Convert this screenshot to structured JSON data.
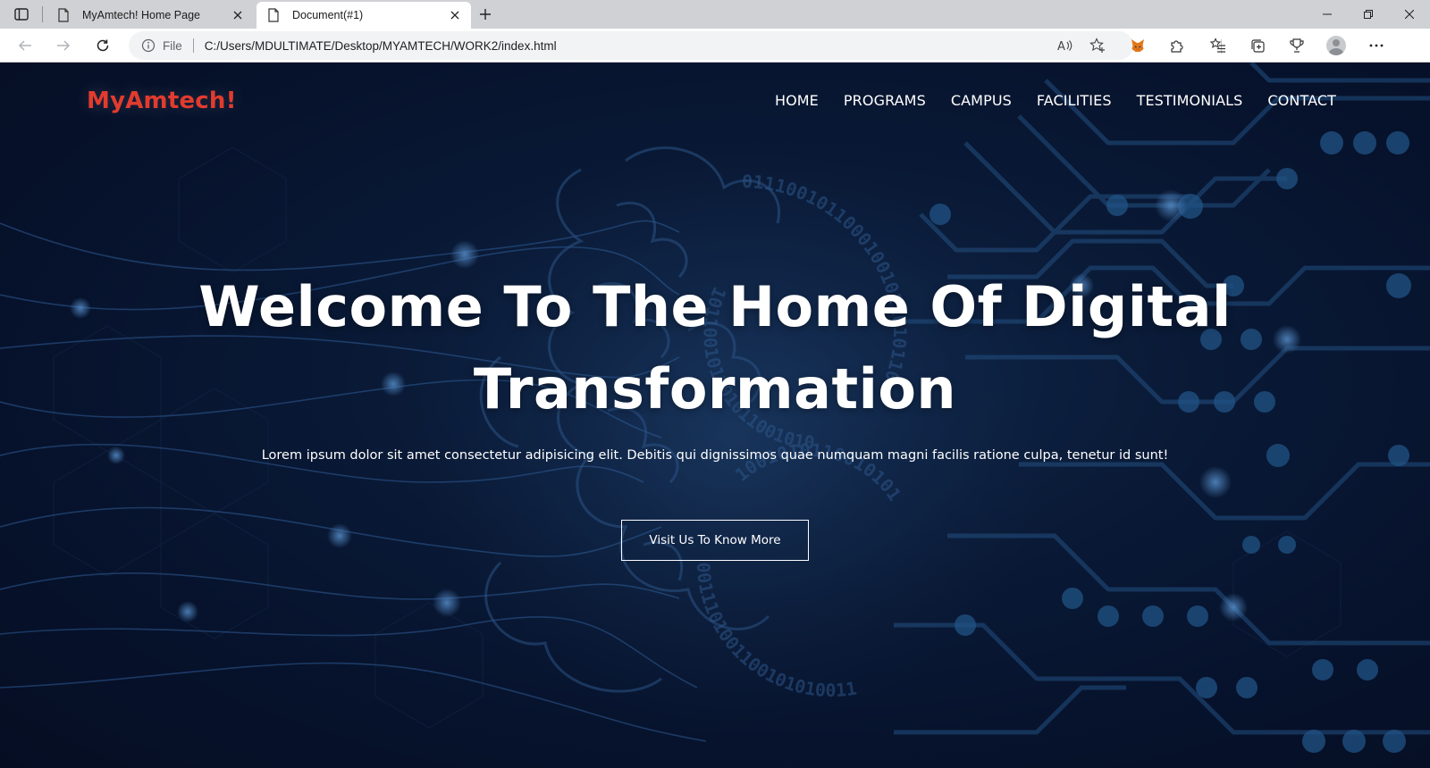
{
  "browser": {
    "tabs": [
      {
        "title": "MyAmtech! Home Page",
        "active": false
      },
      {
        "title": "Document(#1)",
        "active": true
      }
    ],
    "address": {
      "scheme_label": "File",
      "url": "C:/Users/MDULTIMATE/Desktop/MYAMTECH/WORK2/index.html"
    },
    "icons": {
      "sidebar": "tab-actions-icon",
      "new_tab": "plus-icon",
      "minimize": "minimize-icon",
      "restore": "restore-icon",
      "close": "close-icon",
      "back": "back-arrow-icon",
      "forward": "forward-arrow-icon",
      "refresh": "refresh-icon",
      "info": "info-icon",
      "read_aloud": "read-aloud-icon",
      "favorite_add": "star-plus-icon",
      "metamask": "fox-icon",
      "extensions": "puzzle-icon",
      "favorites": "favorites-list-icon",
      "collections": "collections-icon",
      "rewards": "trophy-icon",
      "profile": "avatar-icon",
      "more": "ellipsis-icon"
    }
  },
  "site": {
    "logo": "MyAmtech!",
    "nav": [
      "HOME",
      "PROGRAMS",
      "CAMPUS",
      "FACILITIES",
      "TESTIMONIALS",
      "CONTACT"
    ],
    "hero": {
      "title_line1": "Welcome To The Home Of Digital",
      "title_line2": "Transformation",
      "subtitle": "Lorem ipsum dolor sit amet consectetur adipisicing elit. Debitis qui dignissimos quae numquam magni facilis ratione culpa, tenetur id sunt!",
      "button": "Visit Us To Know More"
    },
    "colors": {
      "logo": "#e23b2e",
      "background": "#0a1a36",
      "text": "#ffffff"
    }
  }
}
